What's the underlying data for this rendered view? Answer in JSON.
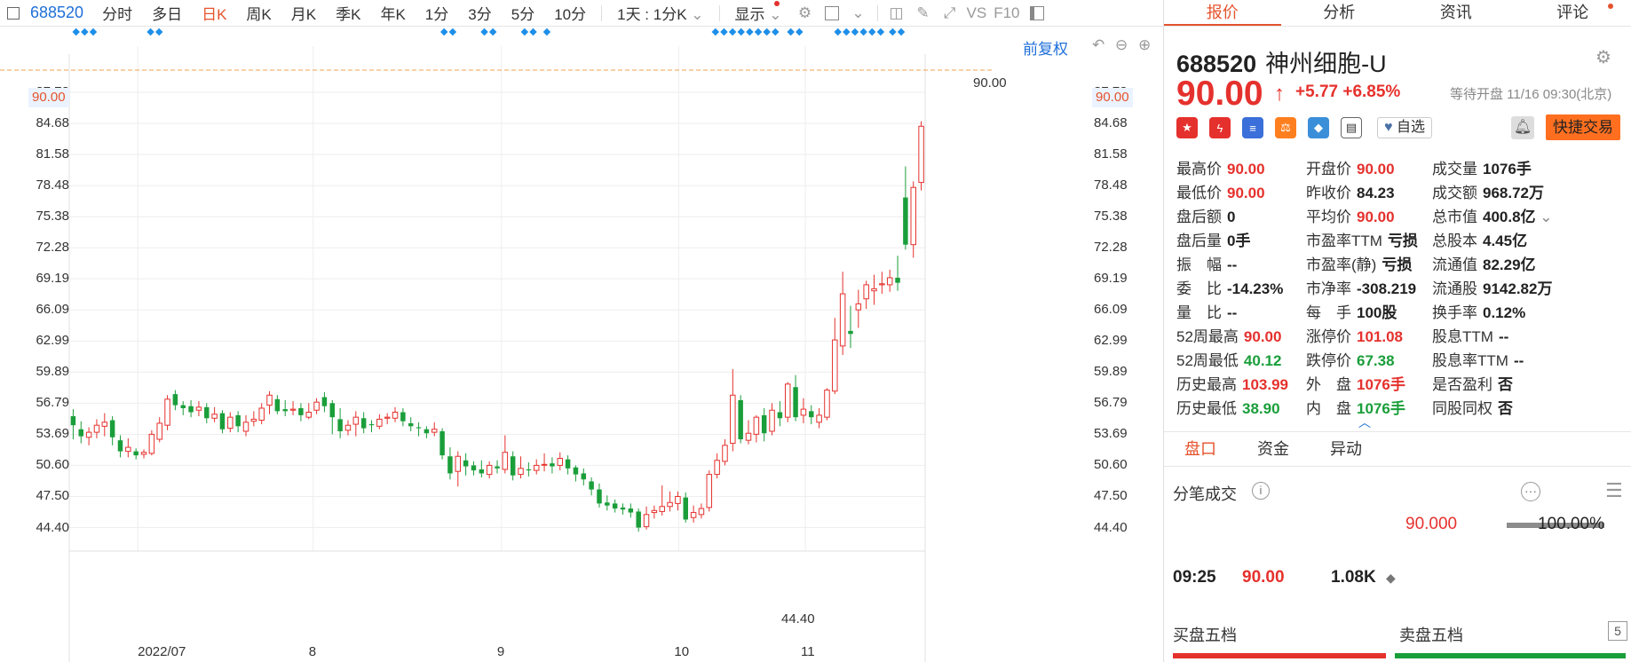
{
  "toolbar": {
    "code": "688520",
    "items": [
      "分时",
      "多日",
      "日K",
      "周K",
      "月K",
      "季K",
      "年K",
      "1分",
      "3分",
      "5分",
      "10分"
    ],
    "active": "日K",
    "period_select": "1天 : 1分K",
    "display": "显示",
    "vs": "VS",
    "f10": "F10"
  },
  "chart": {
    "fq_label": "前复权",
    "y_ticks": [
      "87.78",
      "84.68",
      "81.58",
      "78.48",
      "75.38",
      "72.28",
      "69.19",
      "66.09",
      "62.99",
      "59.89",
      "56.79",
      "53.69",
      "50.60",
      "47.50",
      "44.40"
    ],
    "current_price_label": "90.00",
    "high_annotation": "90.00",
    "low_annotation": "44.40",
    "dates": [
      "2022/07",
      "8",
      "9",
      "10",
      "11"
    ]
  },
  "chart_data": {
    "type": "candlestick",
    "ylim": [
      42.5,
      91.5
    ],
    "reference_line": 90.0,
    "candles": [
      [
        55.5,
        54.6,
        56.2,
        53.2
      ],
      [
        54.2,
        53.5,
        55.0,
        52.8
      ],
      [
        53.4,
        53.9,
        54.4,
        52.6
      ],
      [
        53.9,
        54.6,
        55.2,
        53.3
      ],
      [
        54.5,
        54.9,
        55.8,
        53.5
      ],
      [
        55.1,
        53.4,
        55.5,
        52.6
      ],
      [
        53.1,
        52.0,
        53.6,
        51.4
      ],
      [
        52.0,
        52.4,
        53.3,
        51.4
      ],
      [
        52.0,
        51.6,
        52.3,
        51.2
      ],
      [
        51.7,
        51.9,
        52.2,
        51.3
      ],
      [
        51.8,
        53.7,
        54.1,
        51.6
      ],
      [
        53.2,
        54.8,
        55.4,
        52.9
      ],
      [
        54.6,
        57.2,
        57.6,
        54.1
      ],
      [
        57.7,
        56.6,
        58.1,
        56.1
      ],
      [
        56.6,
        56.3,
        57.0,
        55.6
      ],
      [
        56.5,
        55.9,
        57.1,
        55.4
      ],
      [
        56.1,
        56.4,
        57.0,
        55.5
      ],
      [
        56.4,
        55.3,
        56.8,
        54.8
      ],
      [
        55.3,
        55.7,
        56.4,
        54.9
      ],
      [
        55.8,
        54.2,
        56.1,
        53.8
      ],
      [
        54.3,
        55.4,
        55.9,
        53.9
      ],
      [
        55.6,
        54.5,
        56.0,
        53.9
      ],
      [
        54.0,
        54.9,
        55.6,
        53.5
      ],
      [
        55.0,
        55.2,
        56.0,
        54.5
      ],
      [
        55.1,
        56.3,
        56.8,
        54.7
      ],
      [
        56.6,
        57.6,
        58.0,
        55.7
      ],
      [
        57.2,
        56.0,
        57.6,
        55.7
      ],
      [
        56.2,
        56.0,
        57.1,
        55.5
      ],
      [
        56.1,
        56.2,
        57.0,
        55.6
      ],
      [
        56.3,
        55.6,
        56.8,
        55.0
      ],
      [
        55.4,
        55.9,
        56.8,
        55.2
      ],
      [
        56.1,
        56.9,
        57.3,
        55.7
      ],
      [
        57.4,
        56.5,
        57.9,
        55.9
      ],
      [
        56.8,
        55.4,
        57.1,
        53.7
      ],
      [
        55.2,
        54.0,
        56.3,
        53.3
      ],
      [
        54.1,
        54.6,
        55.1,
        53.6
      ],
      [
        54.7,
        55.4,
        56.0,
        53.5
      ],
      [
        55.3,
        54.3,
        55.9,
        53.8
      ],
      [
        54.7,
        54.6,
        55.1,
        53.9
      ],
      [
        54.5,
        55.2,
        55.7,
        54.2
      ],
      [
        55.3,
        55.4,
        55.8,
        54.7
      ],
      [
        55.3,
        55.9,
        56.4,
        54.9
      ],
      [
        55.9,
        55.0,
        56.3,
        54.5
      ],
      [
        54.8,
        54.5,
        55.4,
        54.0
      ],
      [
        54.4,
        54.3,
        54.9,
        53.5
      ],
      [
        54.2,
        53.8,
        54.5,
        53.3
      ],
      [
        53.9,
        54.2,
        54.9,
        53.5
      ],
      [
        54.0,
        51.6,
        54.3,
        51.2
      ],
      [
        51.5,
        49.8,
        52.4,
        49.2
      ],
      [
        50.0,
        51.5,
        52.0,
        48.5
      ],
      [
        51.1,
        50.5,
        51.8,
        49.6
      ],
      [
        50.6,
        50.1,
        51.0,
        49.6
      ],
      [
        50.2,
        49.8,
        51.1,
        49.4
      ],
      [
        49.7,
        50.6,
        51.0,
        49.3
      ],
      [
        50.5,
        50.3,
        51.1,
        49.8
      ],
      [
        50.2,
        51.9,
        53.6,
        49.8
      ],
      [
        51.5,
        49.6,
        52.0,
        49.1
      ],
      [
        49.7,
        50.3,
        51.5,
        49.3
      ],
      [
        50.2,
        50.1,
        50.9,
        49.5
      ],
      [
        50.1,
        50.6,
        51.2,
        49.7
      ],
      [
        50.7,
        50.7,
        51.8,
        50.0
      ],
      [
        50.8,
        50.5,
        51.4,
        49.8
      ],
      [
        50.6,
        51.3,
        51.9,
        50.1
      ],
      [
        51.2,
        50.3,
        51.6,
        49.7
      ],
      [
        50.4,
        49.7,
        50.6,
        49.0
      ],
      [
        49.8,
        49.2,
        50.3,
        48.6
      ],
      [
        49.0,
        48.2,
        49.4,
        47.6
      ],
      [
        48.2,
        46.8,
        48.8,
        46.4
      ],
      [
        46.9,
        46.6,
        47.6,
        46.1
      ],
      [
        46.8,
        46.3,
        47.2,
        45.9
      ],
      [
        46.4,
        46.2,
        46.8,
        45.7
      ],
      [
        46.3,
        45.9,
        46.8,
        45.4
      ],
      [
        46.0,
        44.4,
        46.3,
        44.0
      ],
      [
        44.5,
        45.7,
        46.5,
        44.2
      ],
      [
        45.9,
        46.1,
        46.6,
        45.3
      ],
      [
        46.0,
        46.5,
        48.6,
        45.6
      ],
      [
        46.5,
        46.9,
        48.0,
        46.0
      ],
      [
        46.8,
        47.5,
        48.0,
        46.1
      ],
      [
        47.4,
        45.2,
        47.9,
        44.9
      ],
      [
        45.4,
        45.9,
        46.6,
        44.9
      ],
      [
        45.7,
        46.3,
        46.8,
        45.3
      ],
      [
        46.4,
        49.7,
        50.1,
        46.0
      ],
      [
        49.7,
        51.1,
        51.8,
        49.3
      ],
      [
        51.0,
        52.6,
        53.2,
        50.6
      ],
      [
        52.8,
        57.6,
        60.2,
        52.0
      ],
      [
        57.1,
        53.2,
        57.6,
        52.8
      ],
      [
        53.1,
        53.8,
        55.1,
        52.7
      ],
      [
        53.7,
        55.4,
        55.6,
        52.9
      ],
      [
        55.6,
        53.8,
        56.3,
        53.0
      ],
      [
        54.0,
        56.1,
        56.8,
        53.6
      ],
      [
        55.9,
        55.3,
        57.0,
        54.5
      ],
      [
        55.4,
        58.7,
        58.9,
        54.9
      ],
      [
        58.4,
        55.4,
        59.6,
        55.0
      ],
      [
        55.6,
        56.2,
        57.3,
        54.8
      ],
      [
        56.0,
        55.4,
        56.6,
        54.7
      ],
      [
        54.9,
        55.6,
        56.3,
        54.3
      ],
      [
        55.4,
        58.1,
        58.3,
        55.1
      ],
      [
        58.0,
        63.1,
        65.3,
        57.7
      ],
      [
        62.5,
        67.7,
        69.9,
        61.6
      ],
      [
        64.0,
        63.7,
        66.5,
        62.3
      ],
      [
        66.1,
        66.7,
        68.1,
        64.3
      ],
      [
        67.2,
        68.6,
        69.0,
        66.2
      ],
      [
        68.0,
        68.2,
        69.6,
        66.6
      ],
      [
        68.6,
        68.7,
        69.9,
        67.7
      ],
      [
        68.6,
        69.3,
        70.1,
        67.9
      ],
      [
        69.3,
        68.8,
        71.5,
        68.0
      ],
      [
        77.3,
        72.6,
        80.4,
        72.1
      ],
      [
        72.6,
        78.3,
        78.9,
        71.3
      ],
      [
        78.8,
        84.4,
        84.9,
        78.0
      ]
    ]
  },
  "panel": {
    "tabs": [
      "报价",
      "分析",
      "资讯",
      "评论"
    ],
    "active_tab": "报价",
    "code": "688520",
    "name": "神州细胞-U",
    "price": "90.00",
    "change": "+5.77",
    "change_pct": "+6.85%",
    "status": "等待开盘 11/16 09:30(北京)",
    "watch_label": "自选",
    "trade_label": "快捷交易",
    "quote_rows": [
      [
        [
          "最高价",
          "90.00",
          "up"
        ],
        [
          "开盘价",
          "90.00",
          "up"
        ],
        [
          "成交量",
          "1076手",
          "nt"
        ]
      ],
      [
        [
          "最低价",
          "90.00",
          "up"
        ],
        [
          "昨收价",
          "84.23",
          "nt"
        ],
        [
          "成交额",
          "968.72万",
          "nt"
        ]
      ],
      [
        [
          "盘后额",
          "0",
          "nt"
        ],
        [
          "平均价",
          "90.00",
          "up"
        ],
        [
          "总市值",
          "400.8亿",
          "nt"
        ]
      ],
      [
        [
          "盘后量",
          "0手",
          "nt"
        ],
        [
          "市盈率TTM",
          "亏损",
          "nt"
        ],
        [
          "总股本",
          "4.45亿",
          "nt"
        ]
      ],
      [
        [
          "振　幅",
          "--",
          "nt"
        ],
        [
          "市盈率(静)",
          "亏损",
          "nt"
        ],
        [
          "流通值",
          "82.29亿",
          "nt"
        ]
      ],
      [
        [
          "委　比",
          "-14.23%",
          "nt"
        ],
        [
          "市净率",
          "-308.219",
          "nt"
        ],
        [
          "流通股",
          "9142.82万",
          "nt"
        ]
      ],
      [
        [
          "量　比",
          "--",
          "nt"
        ],
        [
          "每　手",
          "100股",
          "nt"
        ],
        [
          "换手率",
          "0.12%",
          "nt"
        ]
      ],
      [
        [
          "52周最高",
          "90.00",
          "up"
        ],
        [
          "涨停价",
          "101.08",
          "up"
        ],
        [
          "股息TTM",
          "--",
          "nt"
        ]
      ],
      [
        [
          "52周最低",
          "40.12",
          "dn"
        ],
        [
          "跌停价",
          "67.38",
          "dn"
        ],
        [
          "股息率TTM",
          "--",
          "nt"
        ]
      ],
      [
        [
          "历史最高",
          "103.99",
          "up"
        ],
        [
          "外　盘",
          "1076手",
          "up"
        ],
        [
          "是否盈利",
          "否",
          "nt"
        ]
      ],
      [
        [
          "历史最低",
          "38.90",
          "dn"
        ],
        [
          "内　盘",
          "1076手",
          "dn"
        ],
        [
          "同股同权",
          "否",
          "nt"
        ]
      ]
    ],
    "bottom_tabs": [
      "盘口",
      "资金",
      "异动"
    ],
    "ticks_title": "分笔成交",
    "tick_price_level": "90.000",
    "tick_pct": "100.00%",
    "tick_fraction": 1.0,
    "tick": {
      "time": "09:25",
      "price": "90.00",
      "vol": "1.08K"
    },
    "buy5": "买盘五档",
    "sell5": "卖盘五档",
    "five_num": "5"
  },
  "colors": {
    "up": "#e5312d",
    "down": "#1a9e3a",
    "accent": "#e5532d",
    "link": "#1e6fd9",
    "dash": "#f0a050"
  }
}
